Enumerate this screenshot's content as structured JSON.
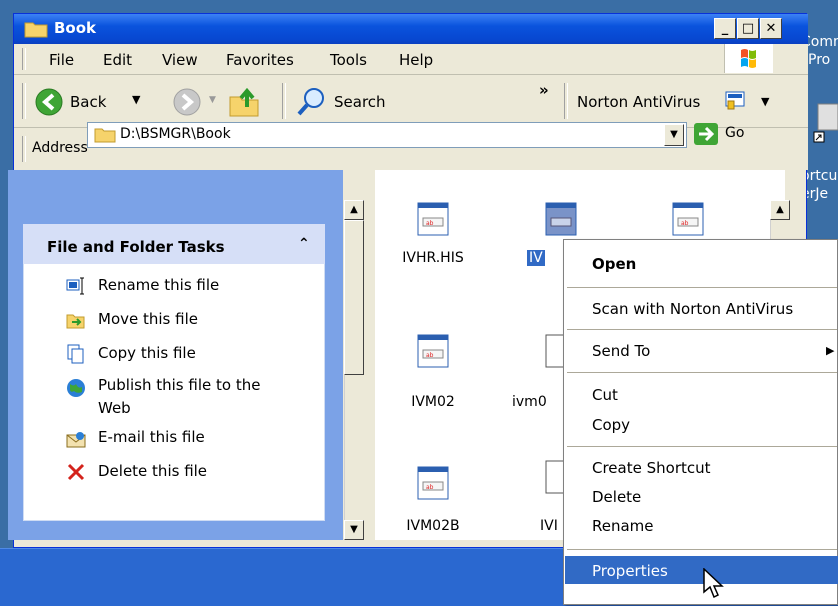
{
  "window": {
    "title": "Book"
  },
  "menu": [
    "File",
    "Edit",
    "View",
    "Favorites",
    "Tools",
    "Help"
  ],
  "toolbar": {
    "back_label": "Back",
    "search_label": "Search",
    "overflow": "»",
    "norton_label": "Norton AntiVirus"
  },
  "address": {
    "label": "Address",
    "value": "D:\\BSMGR\\Book",
    "go_label": "Go"
  },
  "tasks": {
    "title": "File and Folder Tasks",
    "items": [
      {
        "label": "Rename this file",
        "icon": "rename-icon"
      },
      {
        "label": "Move this file",
        "icon": "move-icon"
      },
      {
        "label": "Copy this file",
        "icon": "copy-icon"
      },
      {
        "label": "Publish this file to the",
        "label2": "Web",
        "icon": "publish-icon"
      },
      {
        "label": "E-mail this file",
        "icon": "email-icon"
      },
      {
        "label": "Delete this file",
        "icon": "delete-icon"
      }
    ]
  },
  "files": [
    {
      "name": "IVHR.HIS"
    },
    {
      "name": "IV"
    },
    {
      "name": ""
    },
    {
      "name": "IVM02"
    },
    {
      "name": "ivm0"
    },
    {
      "name": "IVM02B"
    },
    {
      "name": "IVI"
    }
  ],
  "context_menu": {
    "items": [
      "Open",
      "Scan with Norton AntiVirus",
      "Send To",
      "Cut",
      "Copy",
      "Create Shortcut",
      "Delete",
      "Rename",
      "Properties"
    ]
  },
  "desktop": {
    "frag1": "Comm",
    "frag2": "Pro",
    "frag3": "ortcu",
    "frag4": "erJe"
  },
  "colors": {
    "title_blue": "#0a53dd",
    "highlight": "#316ac5",
    "desktop": "#3a6ea5",
    "task_header": "#d6dff7"
  }
}
